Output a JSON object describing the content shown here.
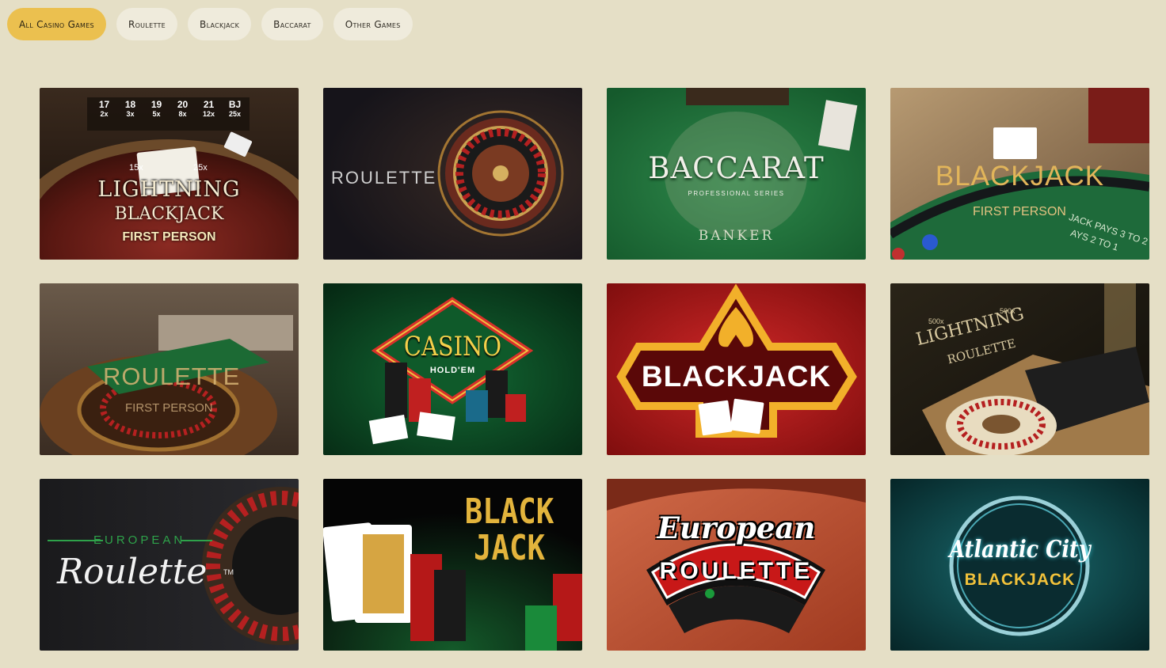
{
  "filters": [
    {
      "label": "All Casino Games",
      "active": true
    },
    {
      "label": "Roulette",
      "active": false
    },
    {
      "label": "Blackjack",
      "active": false
    },
    {
      "label": "Baccarat",
      "active": false
    },
    {
      "label": "Other Games",
      "active": false
    }
  ],
  "games": {
    "g1": {
      "line1": "LIGHTNING",
      "line2": "BLACKJACK",
      "line3": "FIRST PERSON",
      "chips": [
        "17",
        "18",
        "19",
        "20",
        "21",
        "BJ"
      ],
      "mults": [
        "2x",
        "3x",
        "5x",
        "8x",
        "12x",
        "25x"
      ],
      "card_mult_left": "15x",
      "card_mult_right": "25x"
    },
    "g2": {
      "line1": "ROULETTE"
    },
    "g3": {
      "line1": "BACCARAT",
      "line2": "PROFESSIONAL SERIES",
      "line3": "BANKER"
    },
    "g4": {
      "line1": "BLACKJACK",
      "line2": "FIRST PERSON",
      "line3": "JACK PAYS 3 TO 2",
      "line4": "AYS 2 TO 1"
    },
    "g5": {
      "line1": "ROULETTE",
      "line2": "FIRST PERSON"
    },
    "g6": {
      "line1": "CASINO",
      "line2": "HOLD'EM"
    },
    "g7": {
      "line1": "BLACKJACK"
    },
    "g8": {
      "line1": "LIGHTNING",
      "line2": "ROULETTE",
      "badge1": "500x",
      "badge2": "500x"
    },
    "g9": {
      "line1": "EUROPEAN",
      "line2": "Roulette",
      "tm": "TM"
    },
    "g10": {
      "line1": "BLACK",
      "line2": "JACK"
    },
    "g11": {
      "line1": "European",
      "line2": "ROULETTE"
    },
    "g12": {
      "line1": "Atlantic City",
      "line2": "BLACKJACK"
    }
  }
}
